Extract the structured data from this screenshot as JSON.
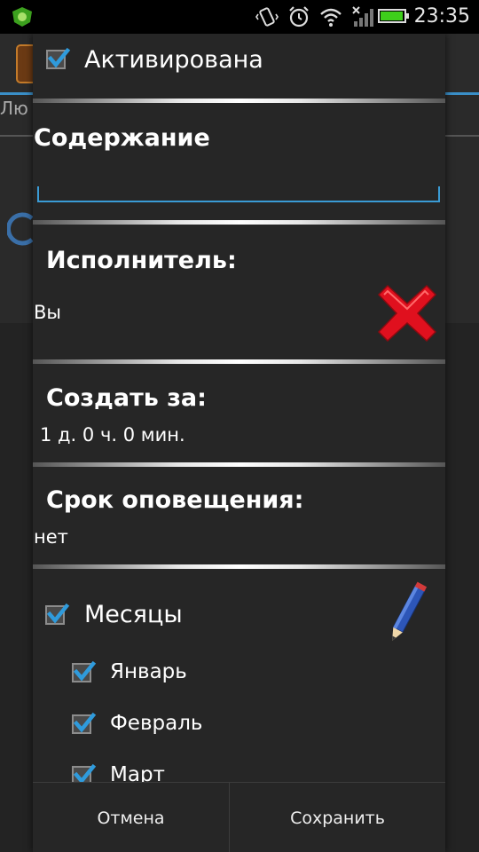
{
  "status_bar": {
    "time": "23:35",
    "icons": [
      "app-notification-icon",
      "vibrate-icon",
      "alarm-icon",
      "wifi-icon",
      "signal-icon",
      "battery-icon"
    ]
  },
  "background_app": {
    "tab_partial": "Лю"
  },
  "dialog": {
    "activated": {
      "label": "Активирована",
      "checked": true
    },
    "content": {
      "title": "Содержание",
      "value": ""
    },
    "executor": {
      "title": "Исполнитель:",
      "value": "Вы"
    },
    "create_before": {
      "title": "Создать за:",
      "value": "1 д. 0 ч. 0 мин."
    },
    "notify_deadline": {
      "title": "Срок оповещения:",
      "value": "нет"
    },
    "months": {
      "label": "Месяцы",
      "checked": true,
      "items": [
        {
          "label": "Январь",
          "checked": true
        },
        {
          "label": "Февраль",
          "checked": true
        },
        {
          "label": "Март",
          "checked": true
        }
      ]
    },
    "buttons": {
      "cancel": "Отмена",
      "save": "Сохранить"
    }
  },
  "colors": {
    "accent": "#3a9bd5",
    "check": "#2f9bdc",
    "delete": "#e0101e",
    "battery": "#3ecf1b"
  }
}
